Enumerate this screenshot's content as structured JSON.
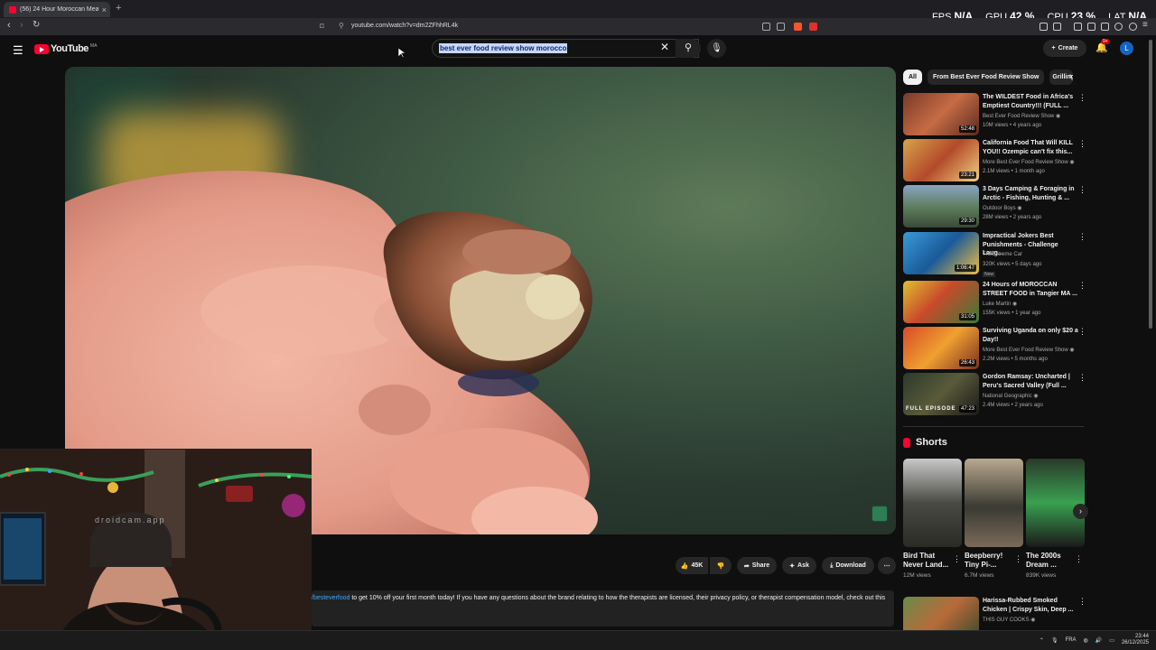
{
  "browser": {
    "tab_title": "(56) 24 Hour Moroccan Mea",
    "new_tab": "+",
    "url": "youtube.com/watch?v=dm2ZFhhRL4k"
  },
  "overlay_stats": [
    {
      "label": "FPS",
      "value": "N/A"
    },
    {
      "label": "GPU",
      "value": "42 %"
    },
    {
      "label": "CPU",
      "value": "23 %"
    },
    {
      "label": "LAT",
      "value": "N/A"
    }
  ],
  "header": {
    "logo": "YouTube",
    "logo_country": "MA",
    "search_query": "best ever food review show morocco",
    "create_label": "Create",
    "notif_badge": "9+",
    "avatar_letter": "L"
  },
  "cam": {
    "watermark": "droidcam.app"
  },
  "actions": {
    "like_count": "45K",
    "share": "Share",
    "ask": "Ask",
    "download": "Download"
  },
  "description": {
    "link": "/besteverfood",
    "text": " to get 10% off your first month today! If you have any questions about the brand relating to how the therapists are licensed, their privacy policy, or therapist compensation model, check out this"
  },
  "chips": [
    "All",
    "From Best Ever Food Review Show",
    "Grilling"
  ],
  "videos": [
    {
      "title": "The WILDEST Food in Africa's Emptiest Country!!! (FULL ...",
      "channel": "Best Ever Food Review Show ◉",
      "meta": "10M views • 4 years ago",
      "duration": "52:48",
      "new": ""
    },
    {
      "title": "California Food That Will KILL YOU!! Ozempic can't fix this...",
      "channel": "More Best Ever Food Review Show ◉",
      "meta": "2.1M views • 1 month ago",
      "duration": "23:21",
      "new": ""
    },
    {
      "title": "3 Days Camping & Foraging in Arctic - Fishing, Hunting & ...",
      "channel": "Outdoor Boys ◉",
      "meta": "28M views • 2 years ago",
      "duration": "29:30",
      "new": ""
    },
    {
      "title": "Impractical Jokers Best Punishments - Challenge Laug...",
      "channel": "TheExtreme Car",
      "meta": "320K views • 5 days ago",
      "duration": "1:06:47",
      "new": "New"
    },
    {
      "title": "24 Hours of MOROCCAN STREET FOOD in Tangier MA ...",
      "channel": "Luke Martin ◉",
      "meta": "155K views • 1 year ago",
      "duration": "31:05",
      "new": ""
    },
    {
      "title": "Surviving Uganda on only $20 a Day!!",
      "channel": "More Best Ever Food Review Show ◉",
      "meta": "2.2M views • 5 months ago",
      "duration": "26:43",
      "new": ""
    },
    {
      "title": "Gordon Ramsay: Uncharted | Peru's Sacred Valley (Full ...",
      "channel": "National Geographic ◉",
      "meta": "2.4M views • 2 years ago",
      "duration": "47:23",
      "new": ""
    },
    {
      "title": "Harissa-Rubbed Smoked Chicken | Crispy Skin, Deep ...",
      "channel": "THIS GUY COOKS ◉",
      "meta": "",
      "duration": "",
      "new": ""
    }
  ],
  "thumb_overlay_text": "FULL EPISODE",
  "shorts": {
    "heading": "Shorts",
    "items": [
      {
        "title": "Bird That Never Land...",
        "views": "12M views"
      },
      {
        "title": "Beepberry! Tiny Pi-...",
        "views": "6.7M views"
      },
      {
        "title": "The 2000s Dream ...",
        "views": "839K views"
      }
    ]
  },
  "taskbar": {
    "lang": "FRA",
    "time": "23:44",
    "date": "26/12/2025"
  },
  "colors": {
    "accent": "#ff0033",
    "bg": "#0f0f0f",
    "link": "#3ea6ff"
  }
}
